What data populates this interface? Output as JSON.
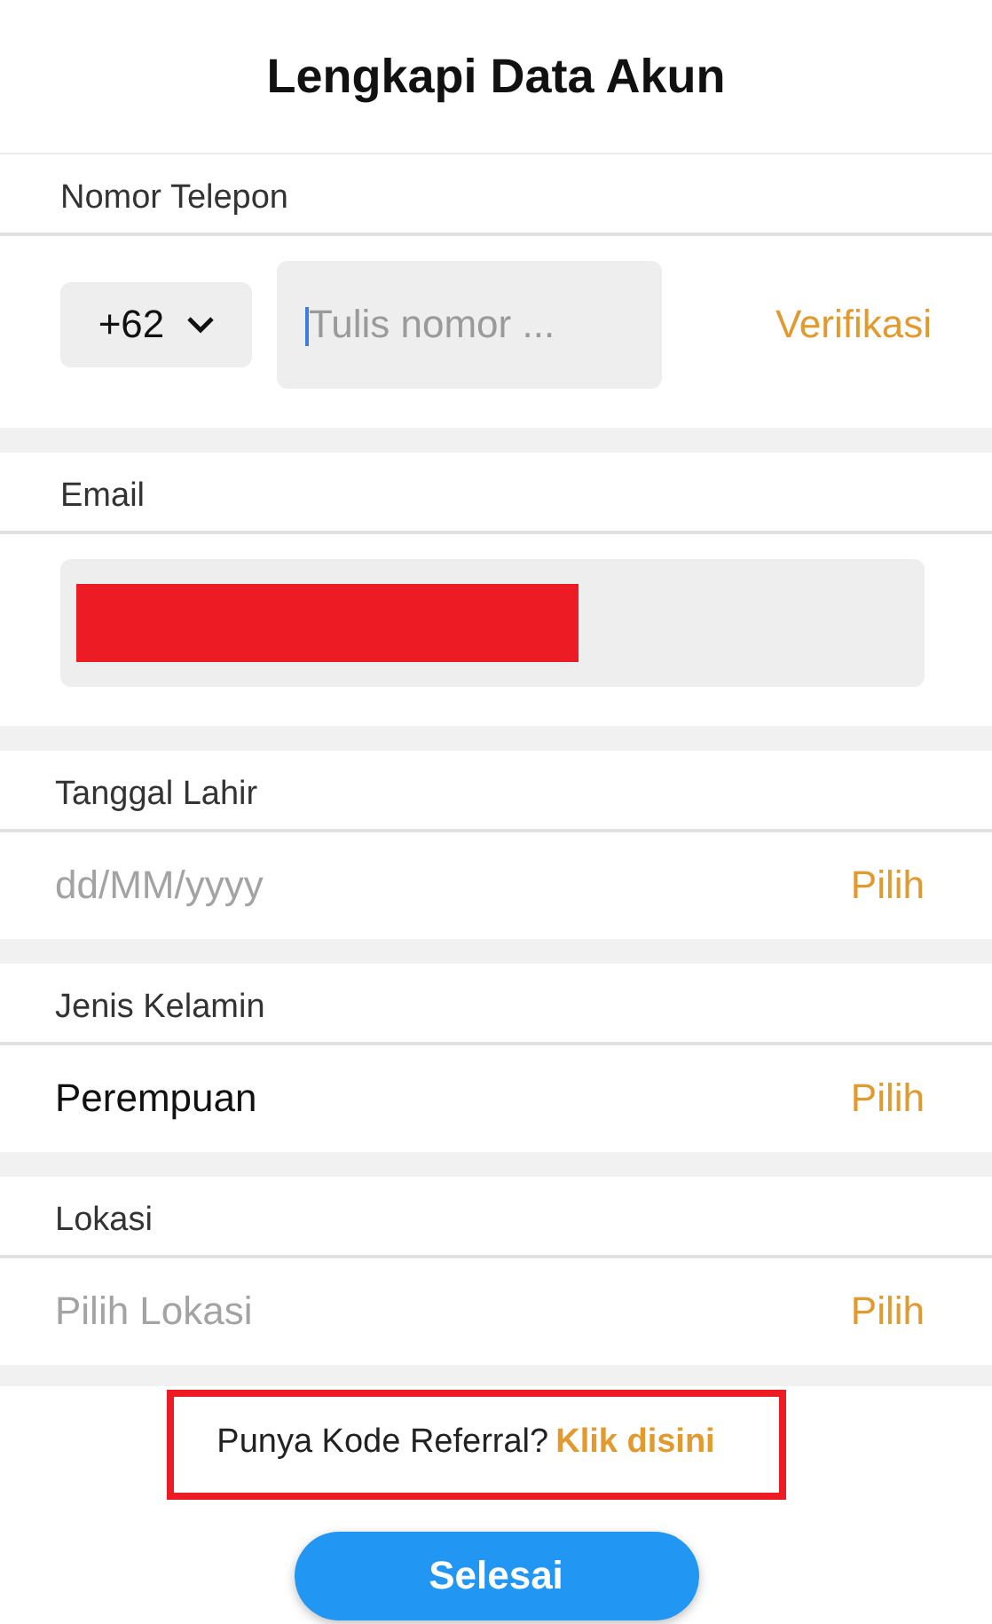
{
  "title": "Lengkapi Data Akun",
  "sections": [
    {
      "kind": "phone",
      "label": "Nomor Telepon",
      "code": "+62",
      "placeholder": "Tulis nomor ...",
      "focused": true,
      "action": "Verifikasi"
    },
    {
      "kind": "email",
      "label": "Email",
      "redacted": true
    },
    {
      "kind": "picker",
      "label": "Tanggal Lahir",
      "placeholder": "dd/MM/yyyy",
      "action": "Pilih"
    },
    {
      "kind": "picker",
      "label": "Jenis Kelamin",
      "value": "Perempuan",
      "action": "Pilih"
    },
    {
      "kind": "picker",
      "label": "Lokasi",
      "placeholder": "Pilih Lokasi",
      "action": "Pilih"
    }
  ],
  "referral": {
    "text": "Punya Kode Referral?",
    "link": "Klik disini",
    "highlighted": true
  },
  "submit_button": "Selesai"
}
